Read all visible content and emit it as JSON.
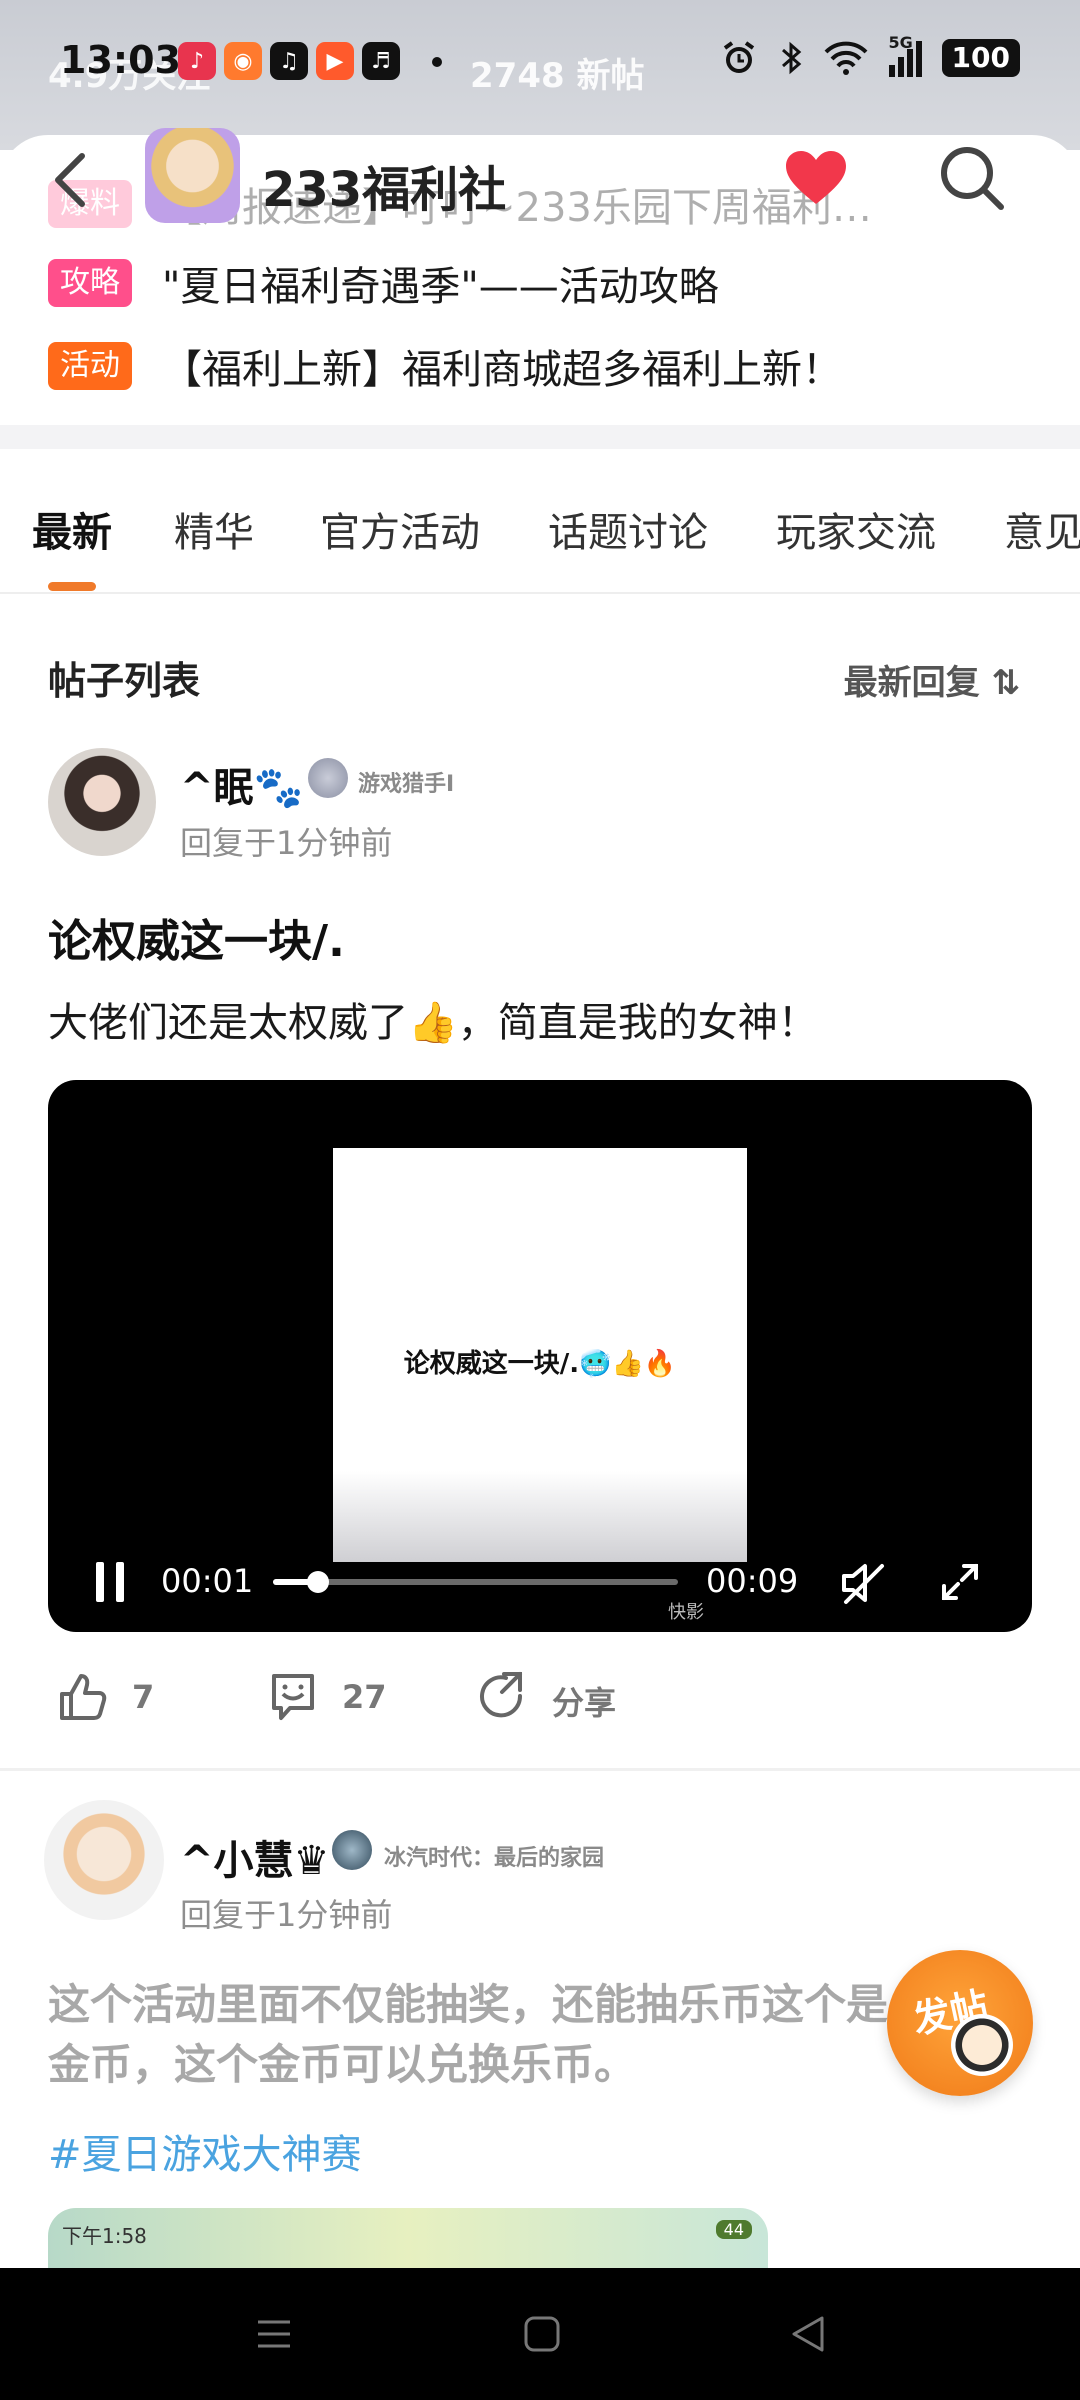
{
  "status_bar": {
    "time": "13:03",
    "behind_text": "4.9万关注",
    "new_posts": "2748 新帖",
    "battery": "100",
    "signal_label": "5G"
  },
  "header": {
    "club_name": "233福利社",
    "notices": [
      {
        "tag": "爆料",
        "tag_color": "#ff6b9a",
        "text": "【周报速递】叮叮~233乐园下周福利…"
      },
      {
        "tag": "攻略",
        "tag_color": "#ff4f8b",
        "text": "\"夏日福利奇遇季\"——活动攻略"
      },
      {
        "tag": "活动",
        "tag_color": "#ff6a1a",
        "text": "【福利上新】福利商城超多福利上新！"
      }
    ]
  },
  "tabs": [
    {
      "label": "最新",
      "active": true
    },
    {
      "label": "精华",
      "active": false
    },
    {
      "label": "官方活动",
      "active": false
    },
    {
      "label": "话题讨论",
      "active": false
    },
    {
      "label": "玩家交流",
      "active": false
    },
    {
      "label": "意见",
      "active": false
    }
  ],
  "list": {
    "title": "帖子列表",
    "sort_label": "最新回复 ⇅"
  },
  "post1": {
    "username": "^眠🐾",
    "badge": "游戏猎手Ⅰ",
    "reply_time": "回复于1分钟前",
    "title": "论权威这一块/.",
    "body": "大佬们还是太权威了👍，简直是我的女神！",
    "video": {
      "caption": "论权威这一块/.🥶👍🔥",
      "current_time": "00:01",
      "total_time": "00:09",
      "progress": 0.11,
      "watermark": "快影"
    },
    "likes": "7",
    "comments": "27",
    "share_label": "分享"
  },
  "post2": {
    "username": "^小慧♛",
    "badge": "冰汽时代：最后的家园",
    "reply_time": "回复于1分钟前",
    "text": "这个活动里面不仅能抽奖，还能抽乐币这个是金币，这个金币可以兑换乐币。",
    "hashtag": "#夏日游戏大神赛",
    "thumb_time": "下午1:58",
    "thumb_battery": "44"
  },
  "fab": {
    "label": "发帖"
  },
  "icons": {
    "back": "back-arrow-icon",
    "heart": "heart-icon",
    "search": "search-icon",
    "like": "thumbs-up-icon",
    "comment": "comment-icon",
    "share": "share-icon",
    "pause": "pause-icon",
    "mute": "mute-icon",
    "fullscreen": "fullscreen-icon"
  },
  "colors": {
    "accent": "#f07a2a",
    "heart": "#f2374b",
    "hashtag": "#4aa3e0"
  }
}
